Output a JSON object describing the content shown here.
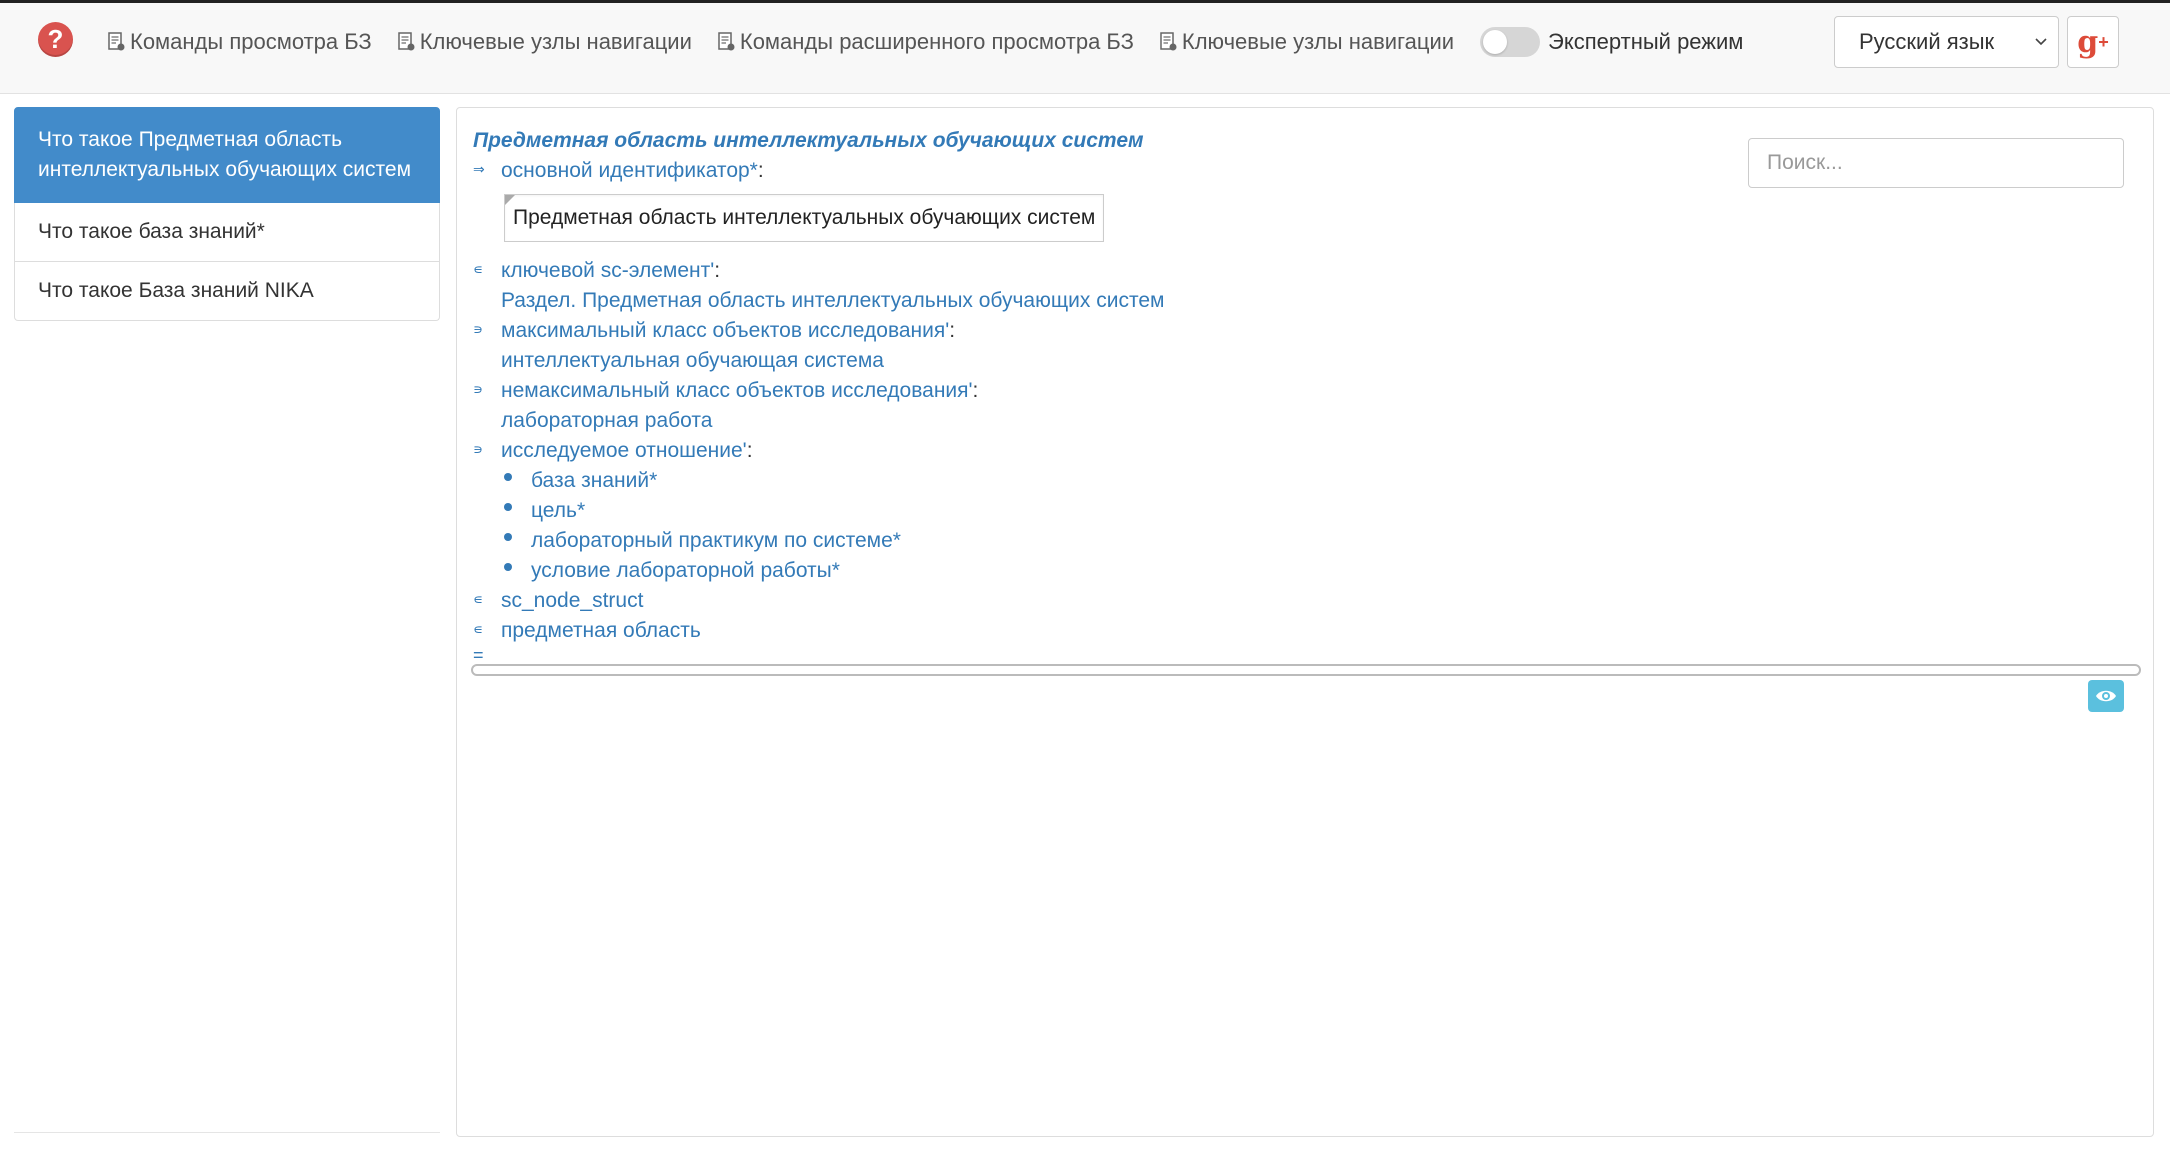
{
  "navbar": {
    "help_label": "?",
    "links": [
      {
        "label": "Команды просмотра БЗ",
        "icon": "document-icon"
      },
      {
        "label": "Ключевые узлы навигации",
        "icon": "document-icon"
      },
      {
        "label": "Команды расширенного просмотра БЗ",
        "icon": "document-icon"
      },
      {
        "label": "Ключевые узлы навигации",
        "icon": "document-icon"
      }
    ],
    "expert_label": "Экспертный режим",
    "expert_enabled": false,
    "language": "Русский язык",
    "gplus_label": "g",
    "gplus_plus": "+"
  },
  "sidebar": {
    "items": [
      {
        "label": "Что такое Предметная область интеллектуальных обучающих систем",
        "active": true
      },
      {
        "label": "Что такое база знаний*",
        "active": false
      },
      {
        "label": "Что такое База знаний NIKA",
        "active": false
      }
    ]
  },
  "main": {
    "search_placeholder": "Поиск...",
    "title": "Предметная область интеллектуальных обучающих систем",
    "identifier_relation": "основной идентификатор*",
    "identifier_value": "Предметная область интеллектуальных обучающих систем",
    "key_element_relation": "ключевой sc-элемент'",
    "key_element_value": "Раздел. Предметная область интеллектуальных обучающих систем",
    "max_class_relation": "максимальный класс объектов исследования'",
    "max_class_value": "интеллектуальная обучающая система",
    "nonmax_class_relation": "немаксимальный класс объектов исследования'",
    "nonmax_class_value": "лабораторная работа",
    "studied_relation": "исследуемое отношение'",
    "studied_items": [
      "база знаний*",
      "цель*",
      "лабораторный практикум по системе*",
      "условие лабораторной работы*"
    ],
    "class_1": "sc_node_struct",
    "class_2": "предметная область",
    "colon": ":",
    "markers": {
      "arrow": "⇒",
      "member": "∊",
      "contains": "∍",
      "equal": "="
    }
  },
  "colors": {
    "accent": "#337ab7",
    "active_bg": "#428bca",
    "help_red": "#d9534f",
    "eye_button": "#5bc0de"
  }
}
